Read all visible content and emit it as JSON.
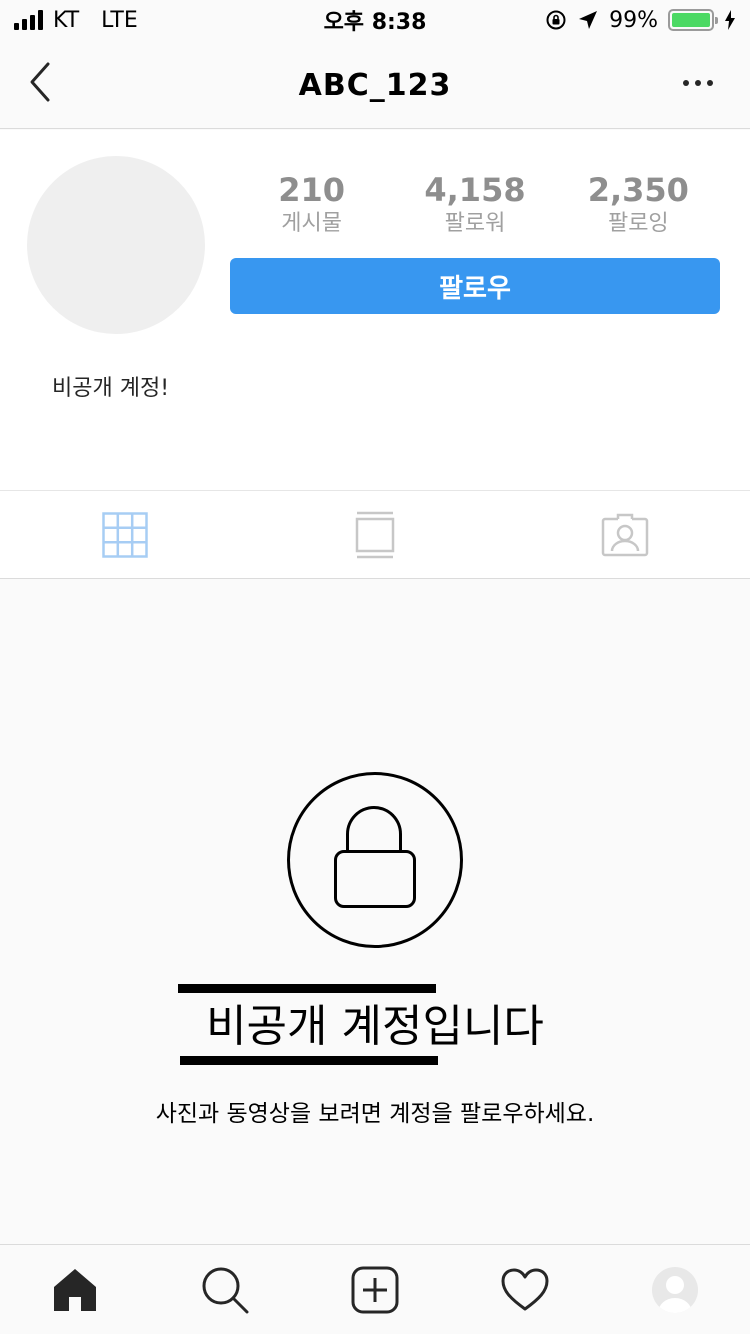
{
  "status_bar": {
    "carrier": "KT",
    "network": "LTE",
    "time": "오후 8:38",
    "battery": "99%",
    "battery_level": 0.99
  },
  "nav": {
    "username": "ABC_123"
  },
  "profile": {
    "stats": [
      {
        "value": "210",
        "label": "게시물"
      },
      {
        "value": "4,158",
        "label": "팔로워"
      },
      {
        "value": "2,350",
        "label": "팔로잉"
      }
    ],
    "follow_label": "팔로우",
    "bio": "비공개 계정!"
  },
  "tabs": [
    {
      "icon": "grid-icon",
      "active": true
    },
    {
      "icon": "feed-icon",
      "active": false
    },
    {
      "icon": "tagged-icon",
      "active": false
    }
  ],
  "private_notice": {
    "title": "비공개 계정입니다",
    "subtitle": "사진과 동영상을 보려면 계정을 팔로우하세요."
  },
  "bottom_bar": [
    {
      "icon": "home-icon"
    },
    {
      "icon": "search-icon"
    },
    {
      "icon": "add-post-icon"
    },
    {
      "icon": "heart-icon"
    },
    {
      "icon": "profile-avatar-icon"
    }
  ],
  "colors": {
    "accent": "#3897f0",
    "active_tab": "#a7cdf4",
    "inactive_icon": "#c7c7c7",
    "battery_fill": "#4cd964"
  }
}
